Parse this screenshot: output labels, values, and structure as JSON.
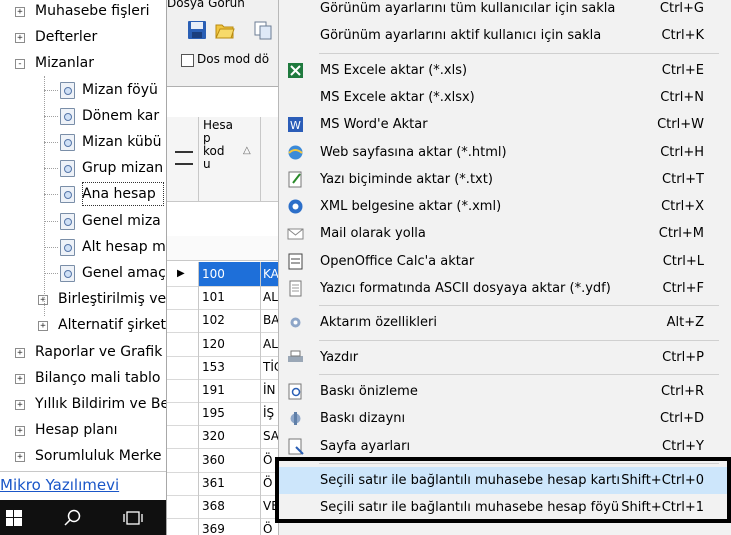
{
  "tree": {
    "items": [
      {
        "label": "Muhasebe fişleri",
        "level": 0,
        "expander": "+"
      },
      {
        "label": "Defterler",
        "level": 0,
        "expander": "+"
      },
      {
        "label": "Mizanlar",
        "level": 0,
        "expander": "−"
      },
      {
        "label": "Mizan föyü",
        "level": 1,
        "icon": "report-icon"
      },
      {
        "label": "Dönem kar",
        "level": 1,
        "icon": "report-icon"
      },
      {
        "label": "Mizan kübü",
        "level": 1,
        "icon": "report-icon"
      },
      {
        "label": "Grup mizan",
        "level": 1,
        "icon": "report-icon"
      },
      {
        "label": "Ana hesap",
        "level": 1,
        "icon": "report-icon",
        "selected": true
      },
      {
        "label": "Genel miza",
        "level": 1,
        "icon": "report-icon"
      },
      {
        "label": "Alt hesap m",
        "level": 1,
        "icon": "report-icon"
      },
      {
        "label": "Genel amaç",
        "level": 1,
        "icon": "report-icon"
      },
      {
        "label": "Birleştirilmiş ve",
        "level": 1,
        "expander": "+"
      },
      {
        "label": "Alternatif şirket",
        "level": 1,
        "expander": "+"
      },
      {
        "label": "Raporlar ve Grafik",
        "level": 0,
        "expander": "+"
      },
      {
        "label": "Bilanço mali tablo",
        "level": 0,
        "expander": "+"
      },
      {
        "label": "Yıllık Bildirim ve Be",
        "level": 0,
        "expander": "+"
      },
      {
        "label": "Hesap planı",
        "level": 0,
        "expander": "+"
      },
      {
        "label": "Sorumluluk Merke",
        "level": 0,
        "expander": "+"
      }
    ],
    "link": "Mikro Yazılımevi"
  },
  "window": {
    "menubar": "Dosya   Görün",
    "dos_mode_label": "Dos mod dö",
    "column_header": "Hesa\np\nkod\nu",
    "rows": [
      {
        "code": "100",
        "name": "KA",
        "selected": true
      },
      {
        "code": "101",
        "name": "AL"
      },
      {
        "code": "102",
        "name": "BA"
      },
      {
        "code": "120",
        "name": "AL"
      },
      {
        "code": "153",
        "name": "TİC"
      },
      {
        "code": "191",
        "name": "İN"
      },
      {
        "code": "195",
        "name": "İŞ"
      },
      {
        "code": "320",
        "name": "SA"
      },
      {
        "code": "360",
        "name": "Ö"
      },
      {
        "code": "361",
        "name": "Ö"
      },
      {
        "code": "368",
        "name": "VE"
      },
      {
        "code": "369",
        "name": "Ö"
      }
    ]
  },
  "menu": {
    "items": [
      {
        "label": "Görünüm ayarlarını tüm kullanıcılar için sakla",
        "shortcut": "Ctrl+G",
        "icon": ""
      },
      {
        "label": "Görünüm ayarlarını aktif kullanıcı için sakla",
        "shortcut": "Ctrl+K",
        "icon": ""
      },
      {
        "sep": true
      },
      {
        "label": "MS Excele aktar (*.xls)",
        "shortcut": "Ctrl+E",
        "icon": "excel-icon"
      },
      {
        "label": "MS Excele aktar (*.xlsx)",
        "shortcut": "Ctrl+N",
        "icon": ""
      },
      {
        "label": "MS Word'e Aktar",
        "shortcut": "Ctrl+W",
        "icon": "word-icon"
      },
      {
        "label": "Web sayfasına aktar (*.html)",
        "shortcut": "Ctrl+H",
        "icon": "web-icon"
      },
      {
        "label": "Yazı biçiminde aktar (*.txt)",
        "shortcut": "Ctrl+T",
        "icon": "text-file-icon"
      },
      {
        "label": "XML belgesine aktar (*.xml)",
        "shortcut": "Ctrl+X",
        "icon": "xml-icon"
      },
      {
        "label": "Mail olarak yolla",
        "shortcut": "Ctrl+M",
        "icon": "mail-icon"
      },
      {
        "label": "OpenOffice Calc'a aktar",
        "shortcut": "Ctrl+L",
        "icon": "calc-icon"
      },
      {
        "label": "Yazıcı formatında ASCII dosyaya aktar (*.ydf)",
        "shortcut": "Ctrl+F",
        "icon": "document-icon"
      },
      {
        "sep": true
      },
      {
        "label": "Aktarım özellikleri",
        "shortcut": "Alt+Z",
        "icon": "settings-icon"
      },
      {
        "sep": true
      },
      {
        "label": "Yazdır",
        "shortcut": "Ctrl+P",
        "icon": "printer-icon"
      },
      {
        "sep": true
      },
      {
        "label": "Baskı önizleme",
        "shortcut": "Ctrl+R",
        "icon": "preview-icon"
      },
      {
        "label": "Baskı dizaynı",
        "shortcut": "Ctrl+D",
        "icon": "design-icon"
      },
      {
        "label": "Sayfa ayarları",
        "shortcut": "Ctrl+Y",
        "icon": "page-setup-icon"
      },
      {
        "sep": true
      },
      {
        "label": "Seçili satır ile bağlantılı muhasebe hesap kartı",
        "shortcut": "Shift+Ctrl+0",
        "icon": "",
        "highlighted": true
      },
      {
        "label": "Seçili satır ile bağlantılı muhasebe hesap föyü",
        "shortcut": "Shift+Ctrl+1",
        "icon": ""
      }
    ]
  },
  "colors": {
    "selection": "#1e6fd9",
    "menu_highlight": "#cde6fb",
    "link": "#1a56c8",
    "taskbar": "#101010"
  }
}
